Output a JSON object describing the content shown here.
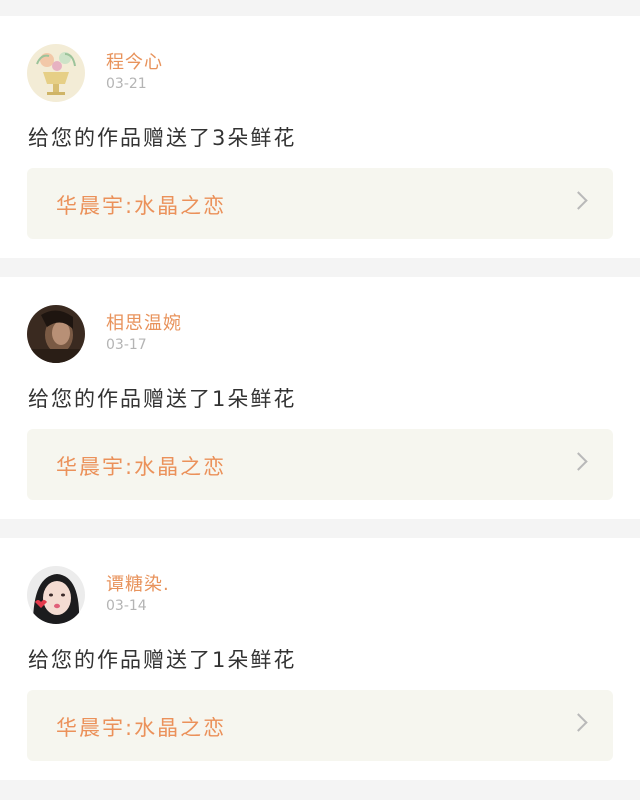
{
  "notifications": [
    {
      "user": "程今心",
      "date": "03-21",
      "message": "给您的作品赠送了3朵鲜花",
      "work_title": "华晨宇:水晶之恋",
      "avatar": "avatar-floral-cup-icon"
    },
    {
      "user": "相思温婉",
      "date": "03-17",
      "message": "给您的作品赠送了1朵鲜花",
      "work_title": "华晨宇:水晶之恋",
      "avatar": "avatar-portrait-dark-icon"
    },
    {
      "user": "谭糖染.",
      "date": "03-14",
      "message": "给您的作品赠送了1朵鲜花",
      "work_title": "华晨宇:水晶之恋",
      "avatar": "avatar-portrait-girl-icon"
    }
  ],
  "colors": {
    "accent": "#eb915a",
    "link_background": "#f6f6ef",
    "page_background": "#f4f4f4"
  }
}
